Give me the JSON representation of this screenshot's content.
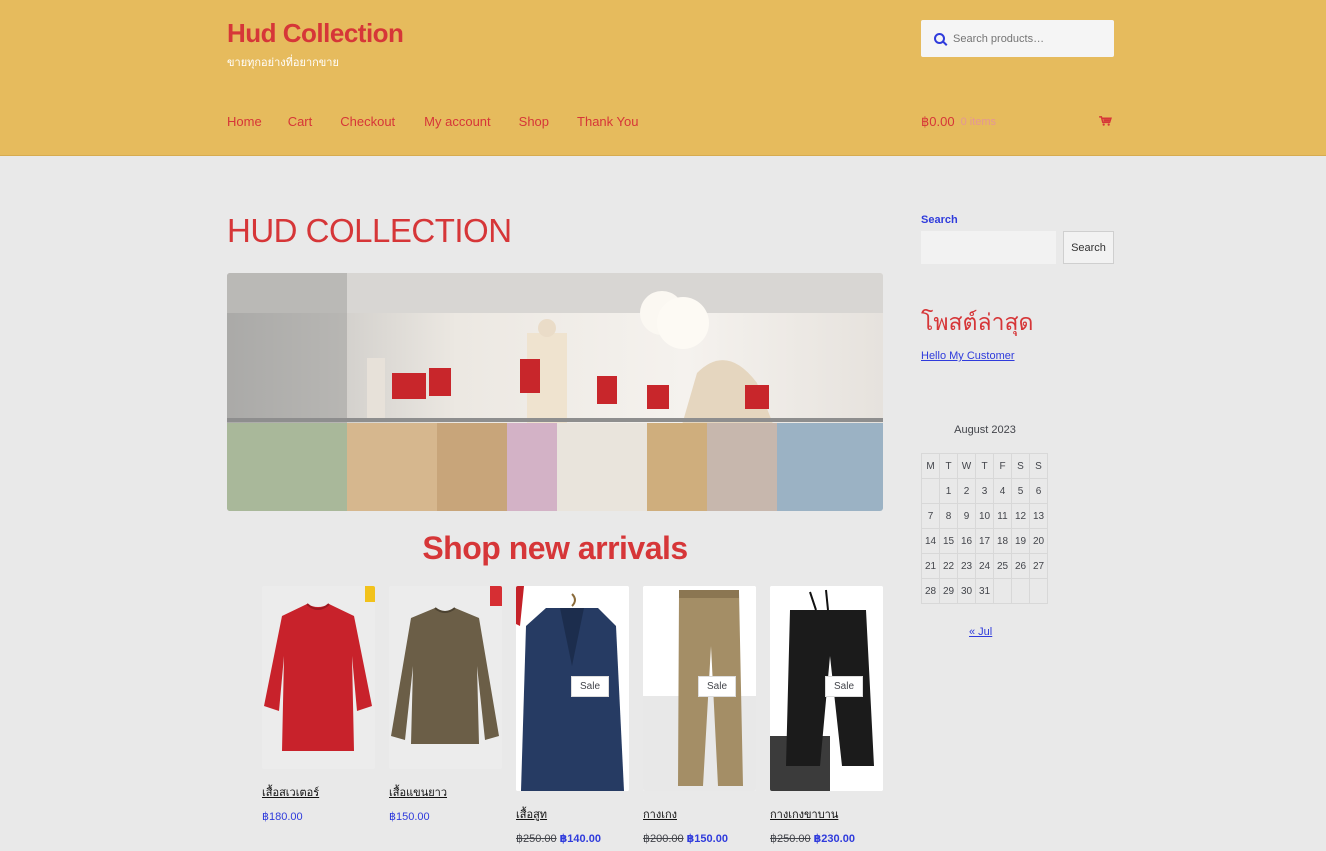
{
  "header": {
    "site_title": "Hud Collection",
    "tagline": "ขายทุกอย่างที่อยากขาย",
    "search_placeholder": "Search products…",
    "nav": [
      "Home",
      "Cart",
      "Checkout",
      "My account",
      "Shop",
      "Thank You"
    ],
    "cart_total": "฿0.00",
    "cart_count": "0 items"
  },
  "main": {
    "page_title": "HUD COLLECTION",
    "section_heading": "Shop new arrivals",
    "products": [
      {
        "name": "เสื้อสเวเตอร์",
        "price": "฿180.00",
        "old_price": "",
        "sale": ""
      },
      {
        "name": "เสื้อแขนยาว",
        "price": "฿150.00",
        "old_price": "",
        "sale": ""
      },
      {
        "name": "เสื้อสูท",
        "price": "฿140.00",
        "old_price": "฿250.00",
        "sale": "Sale"
      },
      {
        "name": "กางเกง",
        "price": "฿150.00",
        "old_price": "฿200.00",
        "sale": "Sale"
      },
      {
        "name": "กางเกงขาบาน",
        "price": "฿230.00",
        "old_price": "฿250.00",
        "sale": "Sale"
      }
    ]
  },
  "sidebar": {
    "search_label": "Search",
    "search_button": "Search",
    "recent_title": "โพสต์ล่าสุด",
    "recent_post": "Hello My Customer",
    "calendar": {
      "caption": "August 2023",
      "weekdays": [
        "M",
        "T",
        "W",
        "T",
        "F",
        "S",
        "S"
      ],
      "weeks": [
        [
          "",
          "1",
          "2",
          "3",
          "4",
          "5",
          "6"
        ],
        [
          "7",
          "8",
          "9",
          "10",
          "11",
          "12",
          "13"
        ],
        [
          "14",
          "15",
          "16",
          "17",
          "18",
          "19",
          "20"
        ],
        [
          "21",
          "22",
          "23",
          "24",
          "25",
          "26",
          "27"
        ],
        [
          "28",
          "29",
          "30",
          "31",
          "",
          "",
          ""
        ]
      ],
      "prev_link": "« Jul"
    }
  },
  "colors": {
    "header_bg": "#e6bb5d",
    "accent_red": "#d63638",
    "link_blue": "#2f3bdc",
    "page_bg": "#e9e9e9"
  },
  "icons": [
    "search-icon",
    "cart-icon"
  ]
}
